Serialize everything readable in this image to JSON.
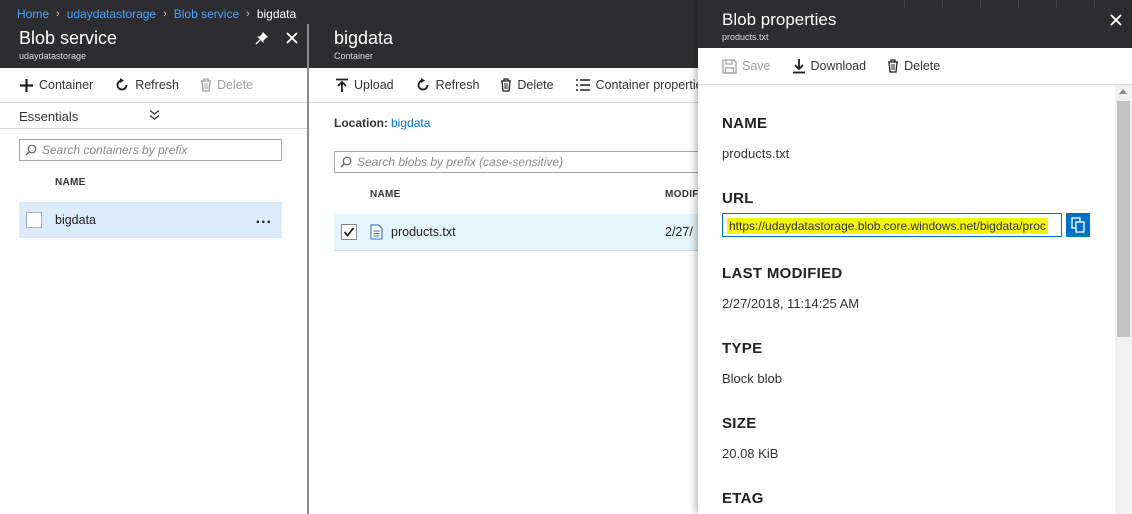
{
  "breadcrumb": {
    "items": [
      "Home",
      "udaydatastorage",
      "Blob service"
    ],
    "current": "bigdata"
  },
  "blob_service": {
    "title": "Blob service",
    "subtitle": "udaydatastorage",
    "toolbar": {
      "container": "Container",
      "refresh": "Refresh",
      "delete": "Delete"
    },
    "essentials": "Essentials",
    "search_placeholder": "Search containers by prefix",
    "column_name": "NAME",
    "rows": [
      {
        "name": "bigdata",
        "more": "..."
      }
    ]
  },
  "container": {
    "title": "bigdata",
    "subtitle": "Container",
    "toolbar": {
      "upload": "Upload",
      "refresh": "Refresh",
      "delete": "Delete",
      "properties": "Container properties"
    },
    "location_label": "Location:",
    "location_value": "bigdata",
    "search_placeholder": "Search blobs by prefix (case-sensitive)",
    "columns": {
      "name": "NAME",
      "modified": "MODIF"
    },
    "rows": [
      {
        "name": "products.txt",
        "modified": "2/27/",
        "checked": true
      }
    ]
  },
  "blob_properties": {
    "title": "Blob properties",
    "subtitle": "products.txt",
    "toolbar": {
      "save": "Save",
      "download": "Download",
      "delete": "Delete"
    },
    "name_label": "NAME",
    "name_value": "products.txt",
    "url_label": "URL",
    "url_value": "https://udaydatastorage.blob.core.windows.net/bigdata/proc",
    "last_modified_label": "LAST MODIFIED",
    "last_modified_value": "2/27/2018, 11:14:25 AM",
    "type_label": "TYPE",
    "type_value": "Block blob",
    "size_label": "SIZE",
    "size_value": "20.08 KiB",
    "etag_label": "ETAG"
  },
  "colors": {
    "header_bg": "#2d2d30",
    "link": "#0072c6",
    "breadcrumb_link": "#4aa3ff",
    "selected_row": "#dcebf9",
    "url_highlight": "#f4f40a"
  }
}
